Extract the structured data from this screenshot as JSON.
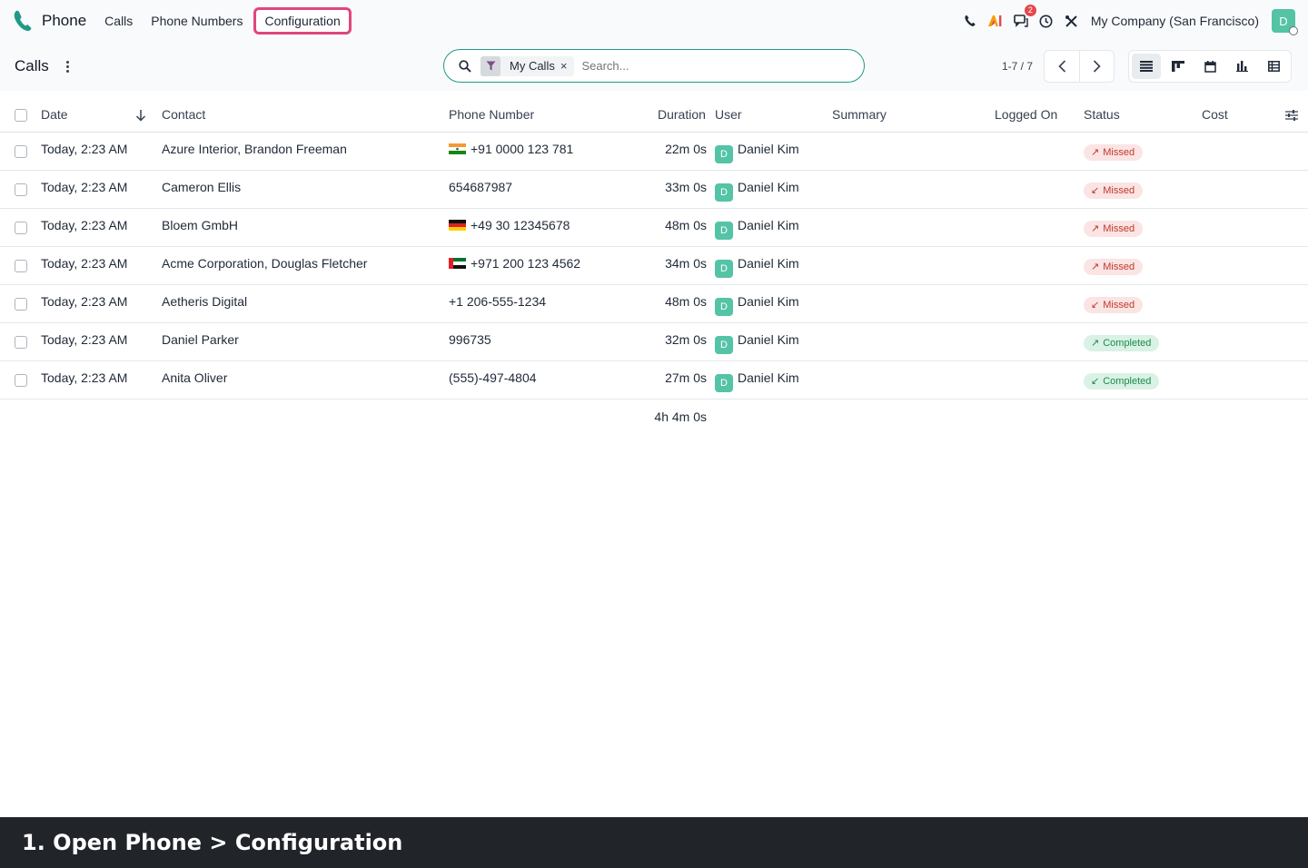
{
  "nav": {
    "app_title": "Phone",
    "items": [
      {
        "label": "Calls"
      },
      {
        "label": "Phone Numbers"
      },
      {
        "label": "Configuration"
      }
    ],
    "messages_badge": "2",
    "company": "My Company (San Francisco)",
    "avatar_initial": "D"
  },
  "control": {
    "breadcrumb": "Calls",
    "search": {
      "facet_label": "My Calls",
      "facet_remove": "×",
      "placeholder": "Search..."
    },
    "pager": "1-7 / 7"
  },
  "table": {
    "columns": {
      "date": "Date",
      "contact": "Contact",
      "phone": "Phone Number",
      "duration": "Duration",
      "user": "User",
      "summary": "Summary",
      "logged_on": "Logged On",
      "status": "Status",
      "cost": "Cost"
    },
    "rows": [
      {
        "date": "Today, 2:23 AM",
        "contact": "Azure Interior, Brandon Freeman",
        "flag": "in",
        "phone": "+91 0000 123 781",
        "duration": "22m 0s",
        "user_initial": "D",
        "user": "Daniel Kim",
        "status": "Missed",
        "direction": "outgoing"
      },
      {
        "date": "Today, 2:23 AM",
        "contact": "Cameron Ellis",
        "flag": "",
        "phone": "654687987",
        "duration": "33m 0s",
        "user_initial": "D",
        "user": "Daniel Kim",
        "status": "Missed",
        "direction": "incoming"
      },
      {
        "date": "Today, 2:23 AM",
        "contact": "Bloem GmbH",
        "flag": "de",
        "phone": "+49 30 12345678",
        "duration": "48m 0s",
        "user_initial": "D",
        "user": "Daniel Kim",
        "status": "Missed",
        "direction": "outgoing"
      },
      {
        "date": "Today, 2:23 AM",
        "contact": "Acme Corporation, Douglas Fletcher",
        "flag": "ae",
        "phone": "+971 200 123 4562",
        "duration": "34m 0s",
        "user_initial": "D",
        "user": "Daniel Kim",
        "status": "Missed",
        "direction": "outgoing"
      },
      {
        "date": "Today, 2:23 AM",
        "contact": "Aetheris Digital",
        "flag": "",
        "phone": "+1 206-555-1234",
        "duration": "48m 0s",
        "user_initial": "D",
        "user": "Daniel Kim",
        "status": "Missed",
        "direction": "incoming"
      },
      {
        "date": "Today, 2:23 AM",
        "contact": "Daniel Parker",
        "flag": "",
        "phone": "996735",
        "duration": "32m 0s",
        "user_initial": "D",
        "user": "Daniel Kim",
        "status": "Completed",
        "direction": "outgoing"
      },
      {
        "date": "Today, 2:23 AM",
        "contact": "Anita Oliver",
        "flag": "",
        "phone": "(555)-497-4804",
        "duration": "27m 0s",
        "user_initial": "D",
        "user": "Daniel Kim",
        "status": "Completed",
        "direction": "incoming"
      }
    ],
    "total_duration": "4h 4m 0s"
  },
  "caption": "1. Open Phone > Configuration",
  "colors": {
    "accent": "#1f9a86",
    "highlight": "#e0467c",
    "avatar": "#55c3a6",
    "missed_bg": "#fbe4e4",
    "missed_fg": "#c0392b",
    "completed_bg": "#d9f2e5",
    "completed_fg": "#1e8a4c"
  },
  "icons": {
    "brand": "phone-handset-icon",
    "systray": [
      "phone-icon",
      "ai-icon",
      "messages-icon",
      "clock-icon",
      "tools-icon"
    ],
    "views": [
      "list-view-icon",
      "kanban-view-icon",
      "calendar-view-icon",
      "graph-view-icon",
      "pivot-view-icon"
    ],
    "sort": "arrow-down-icon",
    "optional_columns": "sliders-icon"
  }
}
